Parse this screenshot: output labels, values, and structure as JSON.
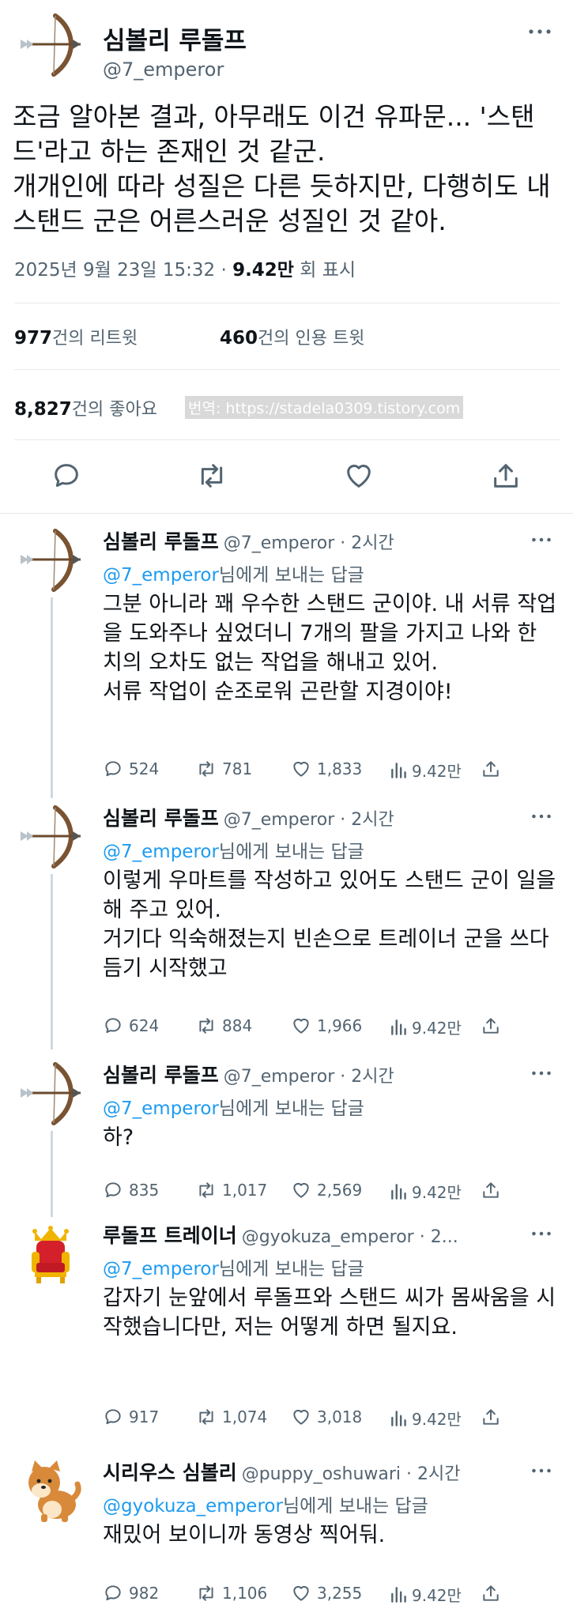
{
  "main": {
    "author": {
      "name": "심볼리 루돌프",
      "handle": "@7_emperor"
    },
    "text": "조금 알아본 결과, 아무래도 이건 유파문... '스탠드'라고 하는 존재인 것 같군.\n개개인에 따라 성질은 다른 듯하지만, 다행히도 내 스탠드 군은 어른스러운 성질인 것 같아.",
    "timestamp": "2025년 9월 23일  15:32 · ",
    "views_value": "9.42만",
    "views_label": " 회 표시",
    "retweets_value": "977",
    "retweets_label": "건의 리트윗",
    "quotes_value": "460",
    "quotes_label": "건의 인용 트윗",
    "likes_value": "8,827",
    "likes_label": "건의 좋아요",
    "watermark": "번역: https://stadela0309.tistory.com",
    "actions": [
      "reply-icon",
      "retweet-icon",
      "like-icon",
      "share-icon"
    ]
  },
  "replies": [
    {
      "name": "심볼리 루돌프",
      "handle": "@7_emperor",
      "time": " · 2시간",
      "to_handle": "@7_emperor",
      "to_suffix": "님에게 보내는 답글",
      "text": "그분 아니라 꽤 우수한 스탠드 군이야. 내 서류 작업을 도와주나 싶었더니 7개의 팔을 가지고 나와 한 치의 오차도 없는 작업을 해내고 있어.\n서류 작업이 순조로워 곤란할 지경이야!",
      "replies": "524",
      "retweets": "781",
      "likes": "1,833",
      "views": "9.42만"
    },
    {
      "name": "심볼리 루돌프",
      "handle": "@7_emperor",
      "time": " · 2시간",
      "to_handle": "@7_emperor",
      "to_suffix": "님에게 보내는 답글",
      "text": "이렇게 우마트를 작성하고 있어도 스탠드 군이 일을 해 주고 있어.\n거기다 익숙해졌는지 빈손으로 트레이너 군을 쓰다듬기 시작했고",
      "replies": "624",
      "retweets": "884",
      "likes": "1,966",
      "views": "9.42만"
    },
    {
      "name": "심볼리 루돌프",
      "handle": "@7_emperor",
      "time": " · 2시간",
      "to_handle": "@7_emperor",
      "to_suffix": "님에게 보내는 답글",
      "text": "하?",
      "replies": "835",
      "retweets": "1,017",
      "likes": "2,569",
      "views": "9.42만"
    },
    {
      "name": "루돌프 트레이너",
      "handle": "@gyokuza_emperor",
      "time": " · 2...",
      "to_handle": "@7_emperor",
      "to_suffix": "님에게 보내는 답글",
      "text": "갑자기 눈앞에서 루돌프와 스탠드 씨가 몸싸움을 시작했습니다만, 저는 어떻게 하면 될지요.",
      "replies": "917",
      "retweets": "1,074",
      "likes": "3,018",
      "views": "9.42만"
    },
    {
      "name": "시리우스 심볼리",
      "handle": "@puppy_oshuwari",
      "time": " · 2시간",
      "to_handle": "@gyokuza_emperor",
      "to_suffix": "님에게 보내는 답글",
      "text": "재밌어 보이니까 동영상 찍어둬.",
      "replies": "982",
      "retweets": "1,106",
      "likes": "3,255",
      "views": "9.42만"
    }
  ],
  "colors": {
    "link": "#1d9bf0",
    "muted": "#536471",
    "text": "#0f1419",
    "divider": "#e7e9ea"
  }
}
